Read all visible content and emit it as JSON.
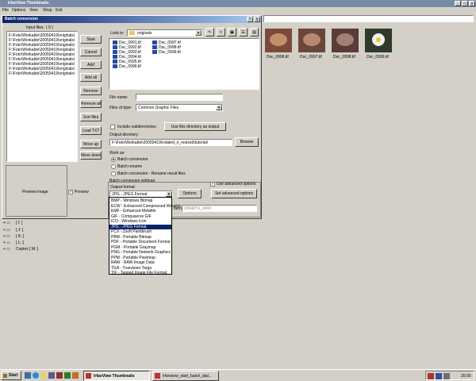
{
  "app": {
    "title": "IrfanView Thumbnails",
    "menu": [
      "File",
      "Options",
      "View",
      "Shop",
      "Exit"
    ],
    "thumbnails": [
      {
        "label": "Dsc_0996.tif"
      },
      {
        "label": "Dsc_0997.tif"
      },
      {
        "label": "Dsc_0998.tif"
      },
      {
        "label": "Dsc_0999.tif"
      }
    ]
  },
  "dialog": {
    "title": "Batch conversion",
    "help": "?",
    "close": "X",
    "input_files_label": "Input files:",
    "input_files_count": "( 9 )",
    "input_files": [
      "F:\\Foto\\Workable\\20050419\\originals\\",
      "F:\\Foto\\Workable\\20050419\\originals\\",
      "F:\\Foto\\Workable\\20050419\\originals\\",
      "F:\\Foto\\Workable\\20050419\\originals\\",
      "F:\\Foto\\Workable\\20050419\\originals\\",
      "F:\\Foto\\Workable\\20050419\\originals\\",
      "F:\\Foto\\Workable\\20050419\\originals\\",
      "F:\\Foto\\Workable\\20050419\\originals\\",
      "F:\\Foto\\Workable\\20050419\\originals\\"
    ],
    "buttons": {
      "start": "Start",
      "cancel": "Cancel",
      "add": "Add",
      "add_all": "Add all",
      "remove": "Remove",
      "remove_all": "Remove all",
      "sort_files": "Sort files",
      "load_txt": "Load TXT",
      "move_up": "Move up",
      "move_down": "Move down",
      "use_dir": "Use this directory as output",
      "browse": "Browse",
      "options": "Options",
      "set_advanced": "Set advanced options"
    },
    "look_in_label": "Look in:",
    "look_in_value": "originals",
    "files_left": [
      "Dsc_0991.tif",
      "Dsc_0992.tif",
      "Dsc_0993.tif",
      "Dsc_0994.tif",
      "Dsc_0995.tif",
      "Dsc_0996.tif"
    ],
    "files_right": [
      "Dsc_0997.tif",
      "Dsc_0998.tif",
      "Dsc_0999.tif"
    ],
    "file_name_label": "File name:",
    "file_name_value": "",
    "files_of_type_label": "Files of type:",
    "files_of_type_value": "Common Graphic Files",
    "include_subdirs": "Include subdirectories",
    "output_dir_label": "Output directory:",
    "output_dir_value": "F:\\Foto\\Workable\\20050419\\rotated_n_resized\\tutorial\\",
    "work_as_label": "Work as:",
    "work_as_options": [
      "Batch conversion",
      "Batch rename",
      "Batch conversion - Rename result files"
    ],
    "settings_label": "Batch conversion settings:",
    "output_format_label": "Output format:",
    "output_format_value": "JPG - JPEG Format",
    "use_advanced": "Use advanced options",
    "name_pattern_value": "20040TX_####",
    "name_pattern_label_tail": "ttern:",
    "preview_image": "Preview image",
    "preview_label": "Preview",
    "format_list": [
      "BMP - Windows Bitmap",
      "ECW - Enhanced Compressed Wavelet",
      "EMF - Enhanced Metafile",
      "GIF - Compuserve GIF",
      "ICO - Windows Icon",
      "JPG - JPEG Format",
      "PCX - Zsoft Paintbrush",
      "PBM - Portable Bitmap",
      "PDF - Portable Document Format",
      "PGM - Portable Graymap",
      "PNG - Portable Network Graphics",
      "PPM - Portable Pixelmap",
      "RAW - RAW Image Data",
      "TGA - Truevision Targa",
      "TIF - Tagged Image File Format"
    ],
    "selected_format_index": 5
  },
  "tree": [
    "[ I: ]",
    "[ J: ]",
    "[ K: ]",
    "[ L: ]",
    "Copies [ M: ]"
  ],
  "taskbar": {
    "start": "Start",
    "tasks": [
      "IrfanView Thumbnails",
      "irfanview_start_batch_dial..."
    ],
    "clock": "20:00"
  }
}
